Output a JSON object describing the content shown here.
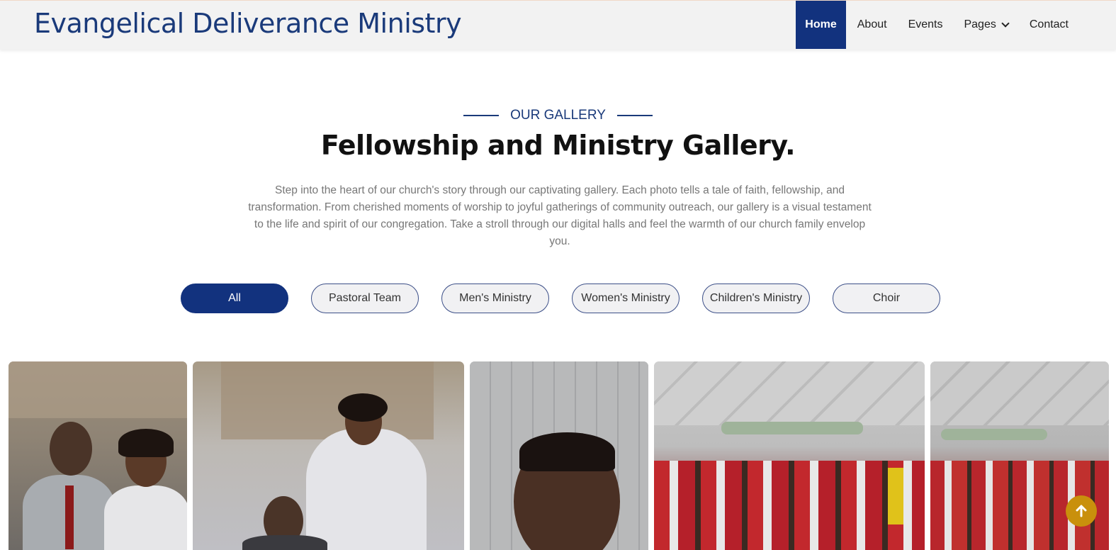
{
  "brand": {
    "name": "Evangelical Deliverance Ministry"
  },
  "nav": {
    "items": [
      {
        "label": "Home",
        "active": true
      },
      {
        "label": "About"
      },
      {
        "label": "Events"
      },
      {
        "label": "Pages",
        "has_dropdown": true
      },
      {
        "label": "Contact"
      }
    ]
  },
  "section": {
    "eyebrow": "OUR GALLERY",
    "title": "Fellowship and Ministry Gallery.",
    "description": "Step into the heart of our church's story through our captivating gallery. Each photo tells a tale of faith, fellowship, and transformation. From cherished moments of worship to joyful gatherings of community outreach, our gallery is a visual testament to the life and spirit of our congregation. Take a stroll through our digital halls and feel the warmth of our church family envelop you."
  },
  "filters": [
    {
      "label": "All",
      "active": true
    },
    {
      "label": "Pastoral Team"
    },
    {
      "label": "Men's Ministry"
    },
    {
      "label": "Women's Ministry"
    },
    {
      "label": "Children's Ministry"
    },
    {
      "label": "Choir"
    }
  ],
  "gallery": {
    "photos": [
      {
        "name": "couple-photo"
      },
      {
        "name": "pastor-seated-photo"
      },
      {
        "name": "portrait-selfie-photo"
      },
      {
        "name": "women-group-photo"
      },
      {
        "name": "congregation-group-photo"
      }
    ]
  },
  "colors": {
    "brand": "#1a3a7a",
    "accent": "#12327e",
    "scroll_top": "#c9900c"
  },
  "icons": {
    "scroll_top": "arrow-up-icon",
    "dropdown": "chevron-down-icon"
  }
}
